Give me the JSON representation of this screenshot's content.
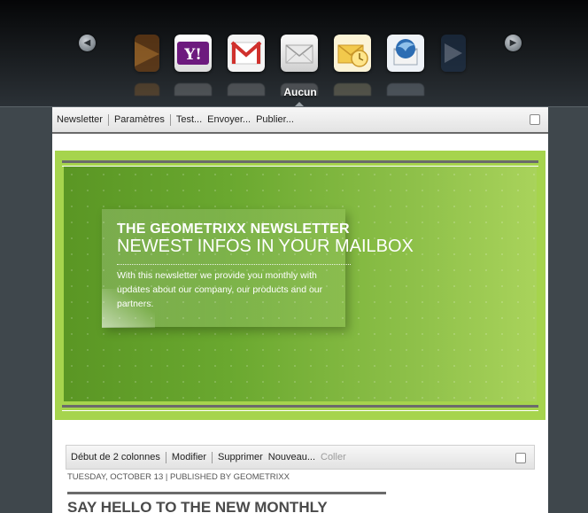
{
  "carousel": {
    "selected_template": "Aucun",
    "prev_label": "◀",
    "next_label": "▶",
    "icons": [
      "partial-orange-icon",
      "yahoo-mail-icon",
      "gmail-icon",
      "plain-mail-icon",
      "outlook-icon",
      "thunderbird-icon",
      "partial-dark-icon"
    ],
    "yahoo_glyph": "Y!"
  },
  "toolbar": {
    "newsletter": "Newsletter",
    "settings": "Paramètres",
    "test": "Test...",
    "send": "Envoyer...",
    "publish": "Publier..."
  },
  "banner": {
    "title": "THE GEOMETRIXX NEWSLETTER",
    "subtitle": "NEWEST INFOS IN YOUR MAILBOX",
    "intro": "With this newsletter we provide you monthly with updates about our company, our products and our partners."
  },
  "section_toolbar": {
    "label": "Début de 2 colonnes",
    "edit": "Modifier",
    "delete": "Supprimer",
    "new": "Nouveau...",
    "paste": "Coller"
  },
  "article": {
    "meta": "TUESDAY, OCTOBER 13 | PUBLISHED BY GEOMETRIXX",
    "title": "SAY HELLO TO THE NEW MONTHLY"
  },
  "colors": {
    "banner_green": "#a6d44d",
    "toolbar_bg": "#e9e9e9",
    "page_bg": "#3f474c"
  }
}
